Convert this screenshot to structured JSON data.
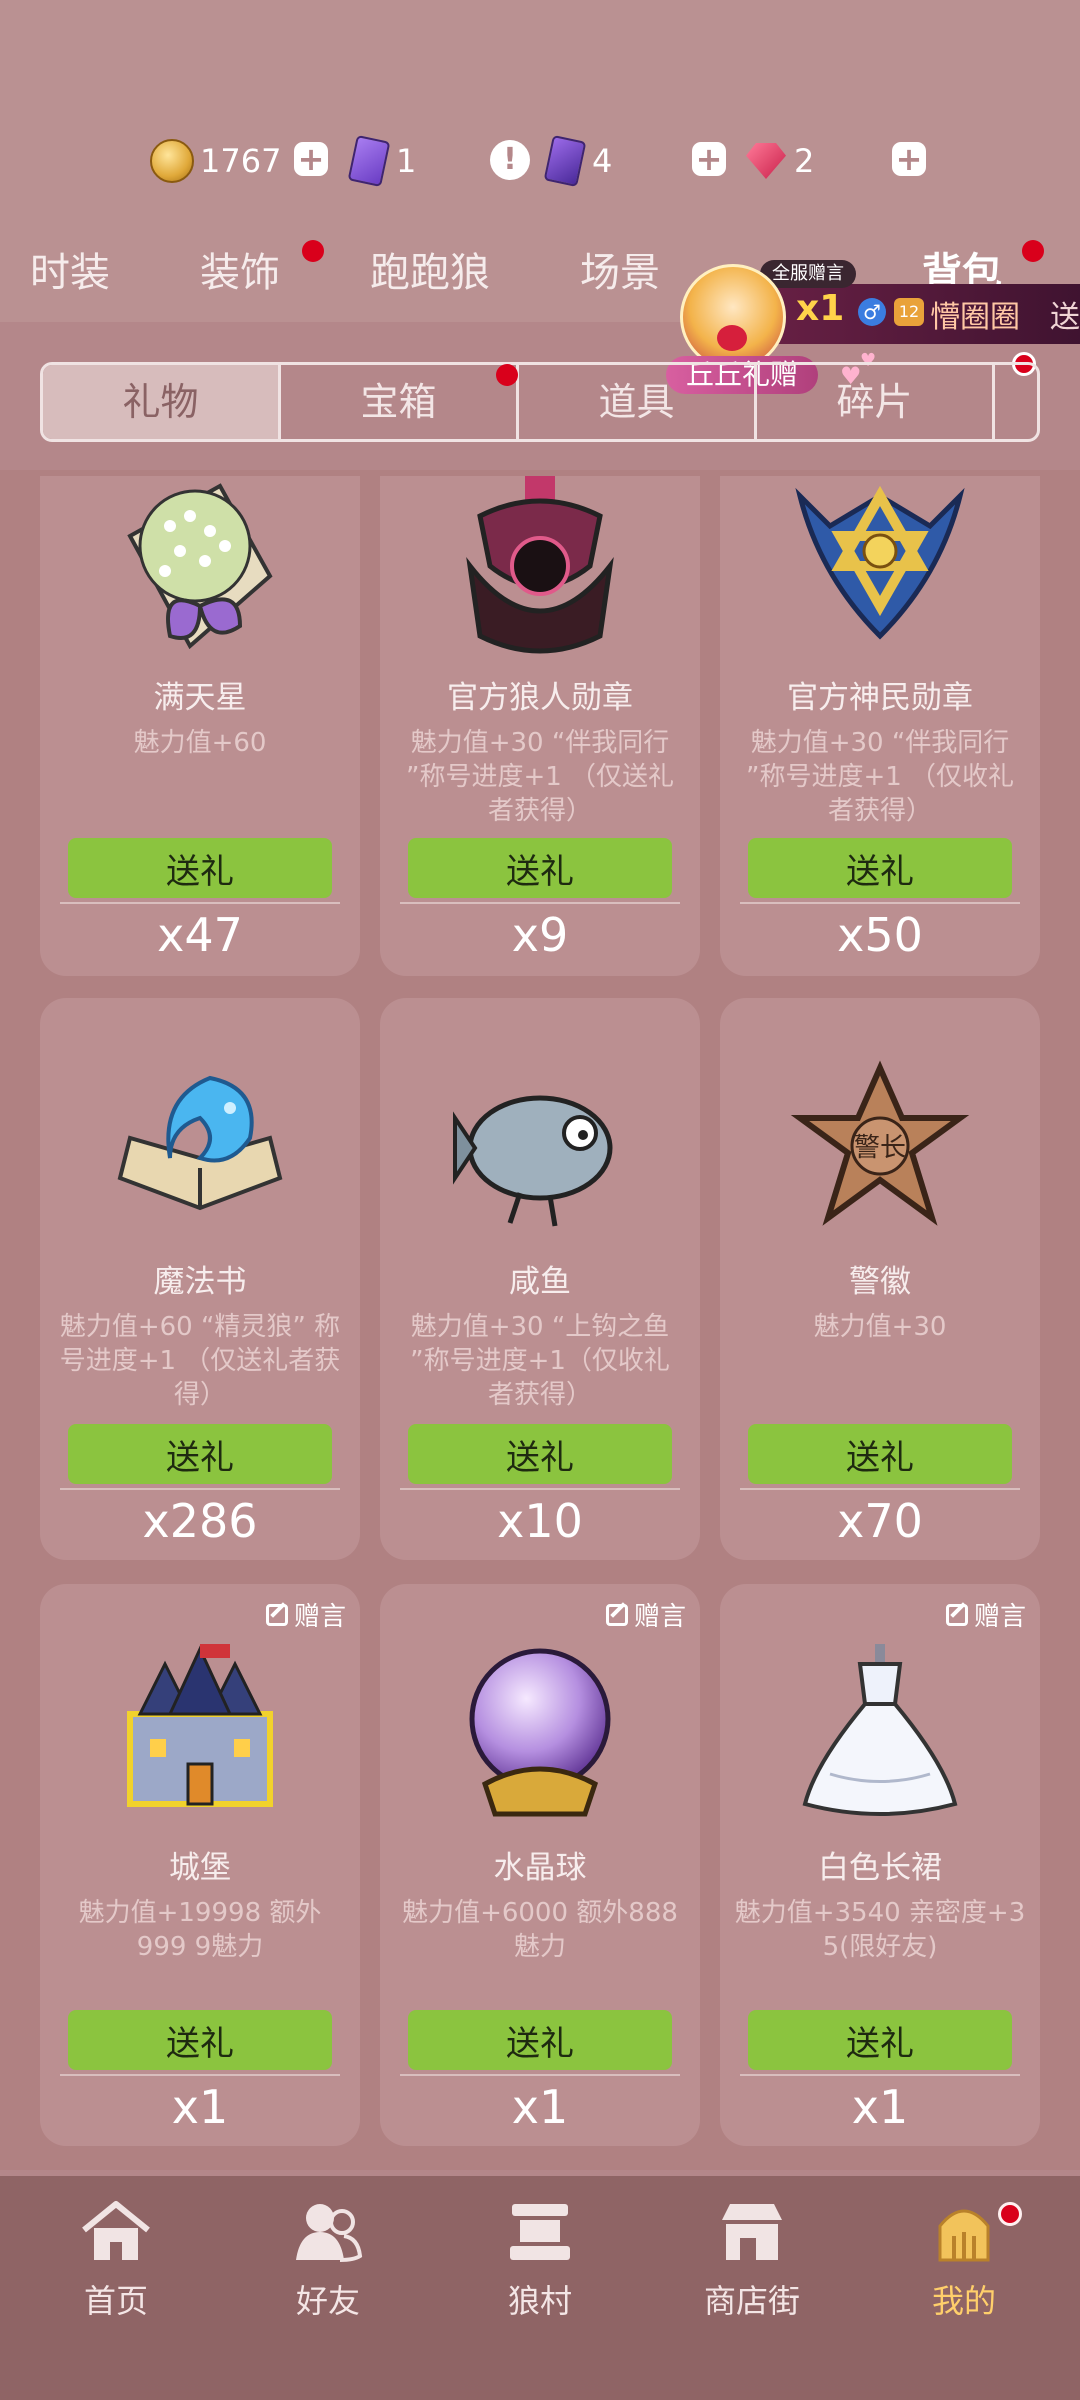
{
  "currencies": {
    "coins": "1767",
    "card_a": "1",
    "card_b": "4",
    "gems": "2"
  },
  "tabs": [
    {
      "label": "时装"
    },
    {
      "label": "装饰"
    },
    {
      "label": "跑跑狼"
    },
    {
      "label": "场景"
    },
    {
      "label": "背包"
    }
  ],
  "banner": {
    "tag": "全服赠言",
    "count": "x1",
    "gender": "♂",
    "level": "12",
    "name": "懵圈圈",
    "send": "送",
    "label": "丘丘礼赠"
  },
  "subtabs": [
    {
      "label": "礼物"
    },
    {
      "label": "宝箱"
    },
    {
      "label": "道具"
    },
    {
      "label": "碎片"
    }
  ],
  "send_label": "送礼",
  "message_label": "赠言",
  "items": [
    {
      "name": "满天星",
      "desc": "魅力值+60",
      "count": "x47"
    },
    {
      "name": "官方狼人勋章",
      "desc": "魅力值+30 “伴我同行 ”称号进度+1 （仅送礼者获得）",
      "count": "x9"
    },
    {
      "name": "官方神民勋章",
      "desc": "魅力值+30 “伴我同行 ”称号进度+1 （仅收礼者获得）",
      "count": "x50"
    },
    {
      "name": "魔法书",
      "desc": "魅力值+60 “精灵狼” 称号进度+1 （仅送礼者获得）",
      "count": "x286"
    },
    {
      "name": "咸鱼",
      "desc": "魅力值+30 “上钩之鱼 ”称号进度+1（仅收礼 者获得）",
      "count": "x10"
    },
    {
      "name": "警徽",
      "desc": "魅力值+30",
      "count": "x70",
      "badge_text": "警长"
    },
    {
      "name": "城堡",
      "desc": "魅力值+19998 额外999 9魅力",
      "count": "x1"
    },
    {
      "name": "水晶球",
      "desc": "魅力值+6000 额外888 魅力",
      "count": "x1"
    },
    {
      "name": "白色长裙",
      "desc": "魅力值+3540 亲密度+3 5(限好友)",
      "count": "x1"
    }
  ],
  "nav": [
    {
      "label": "首页"
    },
    {
      "label": "好友"
    },
    {
      "label": "狼村"
    },
    {
      "label": "商店街"
    },
    {
      "label": "我的"
    }
  ],
  "colors": {
    "background": "#b4878a",
    "card": "#bb8f91",
    "send_button": "#8bc43f",
    "notification_dot": "#d9001b",
    "nav_active": "#ffcf6b"
  }
}
